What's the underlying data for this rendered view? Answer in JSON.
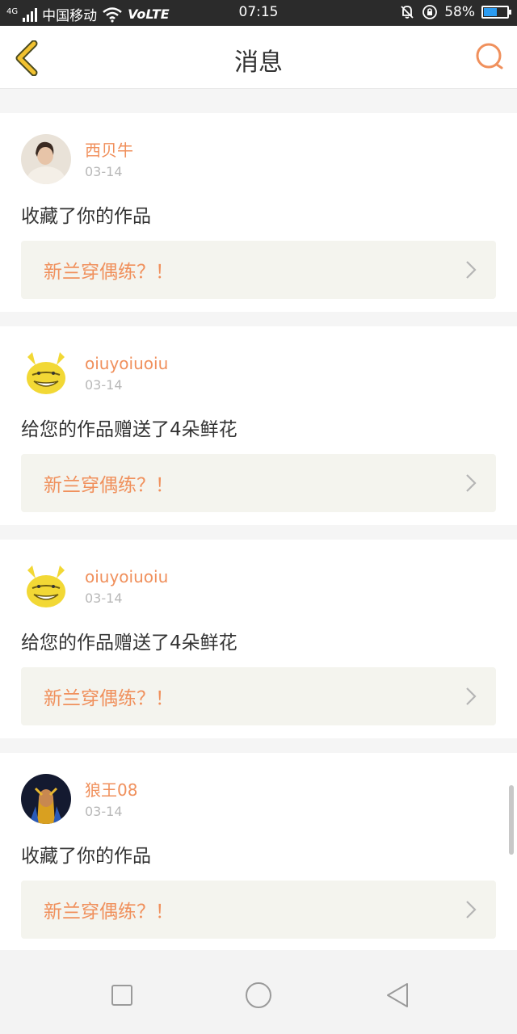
{
  "status_bar": {
    "network_type": "4G",
    "carrier": "中国移动",
    "volte": "VoLTE",
    "time": "07:15",
    "battery_percent": "58%",
    "battery_level": 0.58
  },
  "header": {
    "title": "消息"
  },
  "messages": [
    {
      "username": "西贝牛",
      "date": "03-14",
      "action": "收藏了你的作品",
      "work_title": "新兰穿偶练？！",
      "avatar": "woman-portrait"
    },
    {
      "username": "oiuyoiuoiu",
      "date": "03-14",
      "action": "给您的作品赠送了4朵鲜花",
      "work_title": "新兰穿偶练？！",
      "avatar": "yellow-troll-face"
    },
    {
      "username": "oiuyoiuoiu",
      "date": "03-14",
      "action": "给您的作品赠送了4朵鲜花",
      "work_title": "新兰穿偶练？！",
      "avatar": "yellow-troll-face"
    },
    {
      "username": "狼王08",
      "date": "03-14",
      "action": "收藏了你的作品",
      "work_title": "新兰穿偶练？！",
      "avatar": "game-warrior"
    }
  ],
  "colors": {
    "accent": "#f0905c",
    "back_icon": "#f2c230",
    "link_bg": "#f4f4ee"
  }
}
